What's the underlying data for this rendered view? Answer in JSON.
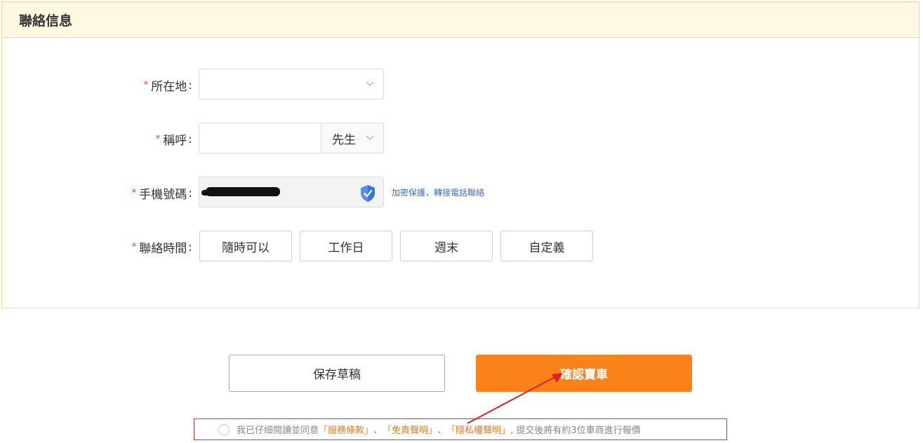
{
  "section": {
    "title": "聯絡信息"
  },
  "form": {
    "required_mark": "*",
    "location": {
      "label": "所在地",
      "value": ""
    },
    "salutation": {
      "label": "稱呼",
      "value": "",
      "title_value": "先生"
    },
    "phone": {
      "label": "手機號碼",
      "note": "加密保護，轉接電話聯絡"
    },
    "contact_time": {
      "label": "聯絡時間",
      "options": [
        "隨時可以",
        "工作日",
        "週末",
        "自定義"
      ]
    }
  },
  "actions": {
    "save_draft": "保存草稿",
    "confirm_sell": "確認賣車"
  },
  "agreement": {
    "prefix": "我已仔細閱讀並同意",
    "terms": "「服務條款」",
    "sep1": "、",
    "disclaimer": "「免責聲明」",
    "sep2": "、",
    "privacy": "「隱私權聲明」",
    "suffix": ", 提交後將有約3位車商進行報價"
  },
  "colors": {
    "accent": "#fa8219",
    "required": "#e23a3a",
    "link": "#3a6fc4",
    "header_bg": "#fff9e3",
    "annotation": "#e02020"
  }
}
